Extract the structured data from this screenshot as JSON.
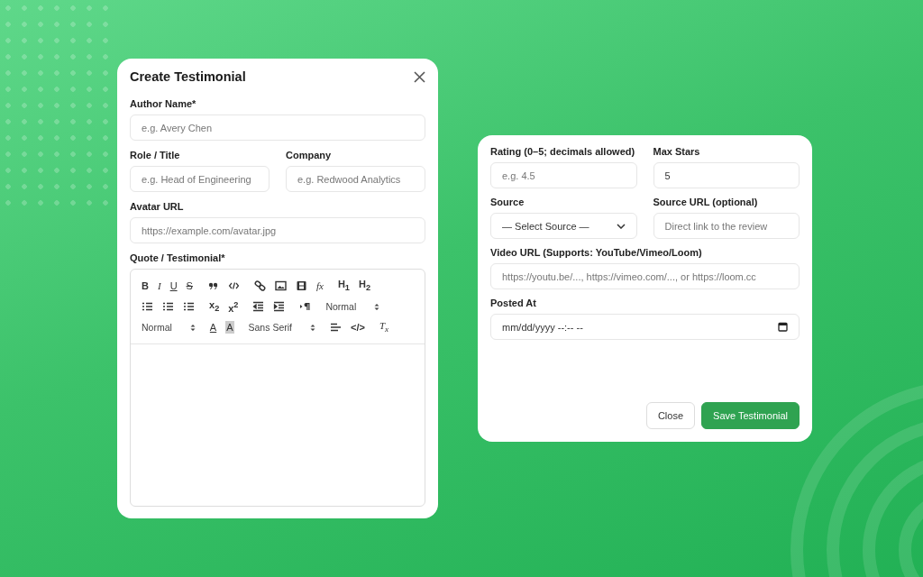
{
  "create_dialog": {
    "title": "Create Testimonial",
    "fields": [
      {
        "kind": "text",
        "label": "Author Name*",
        "placeholder": "e.g. Avery Chen"
      }
    ],
    "pair": [
      {
        "kind": "text",
        "label": "Role / Title",
        "placeholder": "e.g. Head of Engineering"
      },
      {
        "kind": "text",
        "label": "Company",
        "placeholder": "e.g. Redwood Analytics"
      }
    ],
    "avatar": {
      "kind": "text",
      "label": "Avatar URL",
      "placeholder": "https://example.com/avatar.jpg"
    },
    "quote": {
      "label": "Quote / Testimonial*",
      "toolbar": [
        [
          {
            "kind": "bold",
            "label": "B"
          },
          {
            "kind": "italic",
            "label": "I"
          },
          {
            "kind": "underline",
            "label": "U"
          },
          {
            "kind": "strike",
            "label": "S"
          }
        ],
        [
          {
            "kind": "quote"
          },
          {
            "kind": "code"
          }
        ],
        [
          {
            "kind": "link"
          },
          {
            "kind": "image"
          },
          {
            "kind": "video"
          },
          {
            "kind": "formula",
            "label": "fx"
          }
        ],
        [
          {
            "kind": "heading",
            "label": "H$_{1}$"
          },
          {
            "kind": "heading",
            "label": "H$_{2}$"
          }
        ],
        [
          {
            "kind": "ordered"
          },
          {
            "kind": "bullet"
          },
          {
            "kind": "checklist"
          }
        ],
        [
          {
            "kind": "script",
            "label": "x$_{2}$"
          },
          {
            "kind": "script",
            "label": "x$^{2}$"
          }
        ],
        [
          {
            "kind": "outdent"
          },
          {
            "kind": "indent"
          }
        ],
        [
          {
            "kind": "direction"
          }
        ],
        [
          {
            "kind": "select",
            "label": "Normal"
          }
        ],
        [
          {
            "kind": "select",
            "label": "Normal"
          }
        ],
        [
          {
            "kind": "color",
            "label": "A"
          },
          {
            "kind": "background",
            "label": "A"
          }
        ],
        [
          {
            "kind": "select",
            "label": "Sans Serif"
          }
        ],
        [
          {
            "kind": "align"
          },
          {
            "kind": "codeblock",
            "label": "</>"
          }
        ],
        [
          {
            "kind": "clean",
            "label": "T$_{x}$"
          }
        ]
      ]
    }
  },
  "details_dialog": {
    "rows": [
      [
        {
          "kind": "text",
          "label": "Rating (0–5; decimals allowed)",
          "placeholder": "e.g. 4.5"
        },
        {
          "kind": "value",
          "label": "Max Stars",
          "value": "5"
        }
      ],
      [
        {
          "kind": "select",
          "label": "Source",
          "value": "— Select Source —"
        },
        {
          "kind": "text",
          "label": "Source URL (optional)",
          "placeholder": "Direct link to the review"
        }
      ],
      [
        {
          "kind": "text",
          "label": "Video URL (Supports: YouTube/Vimeo/Loom)",
          "placeholder": "https://youtu.be/..., https://vimeo.com/..., or https://loom.cc"
        }
      ],
      [
        {
          "kind": "date",
          "label": "Posted At",
          "placeholder": "mm/dd/yyyy --:-- --"
        }
      ]
    ],
    "buttons": [
      {
        "kind": "secondary",
        "label": "Close"
      },
      {
        "kind": "primary",
        "label": "Save Testimonial"
      }
    ]
  }
}
